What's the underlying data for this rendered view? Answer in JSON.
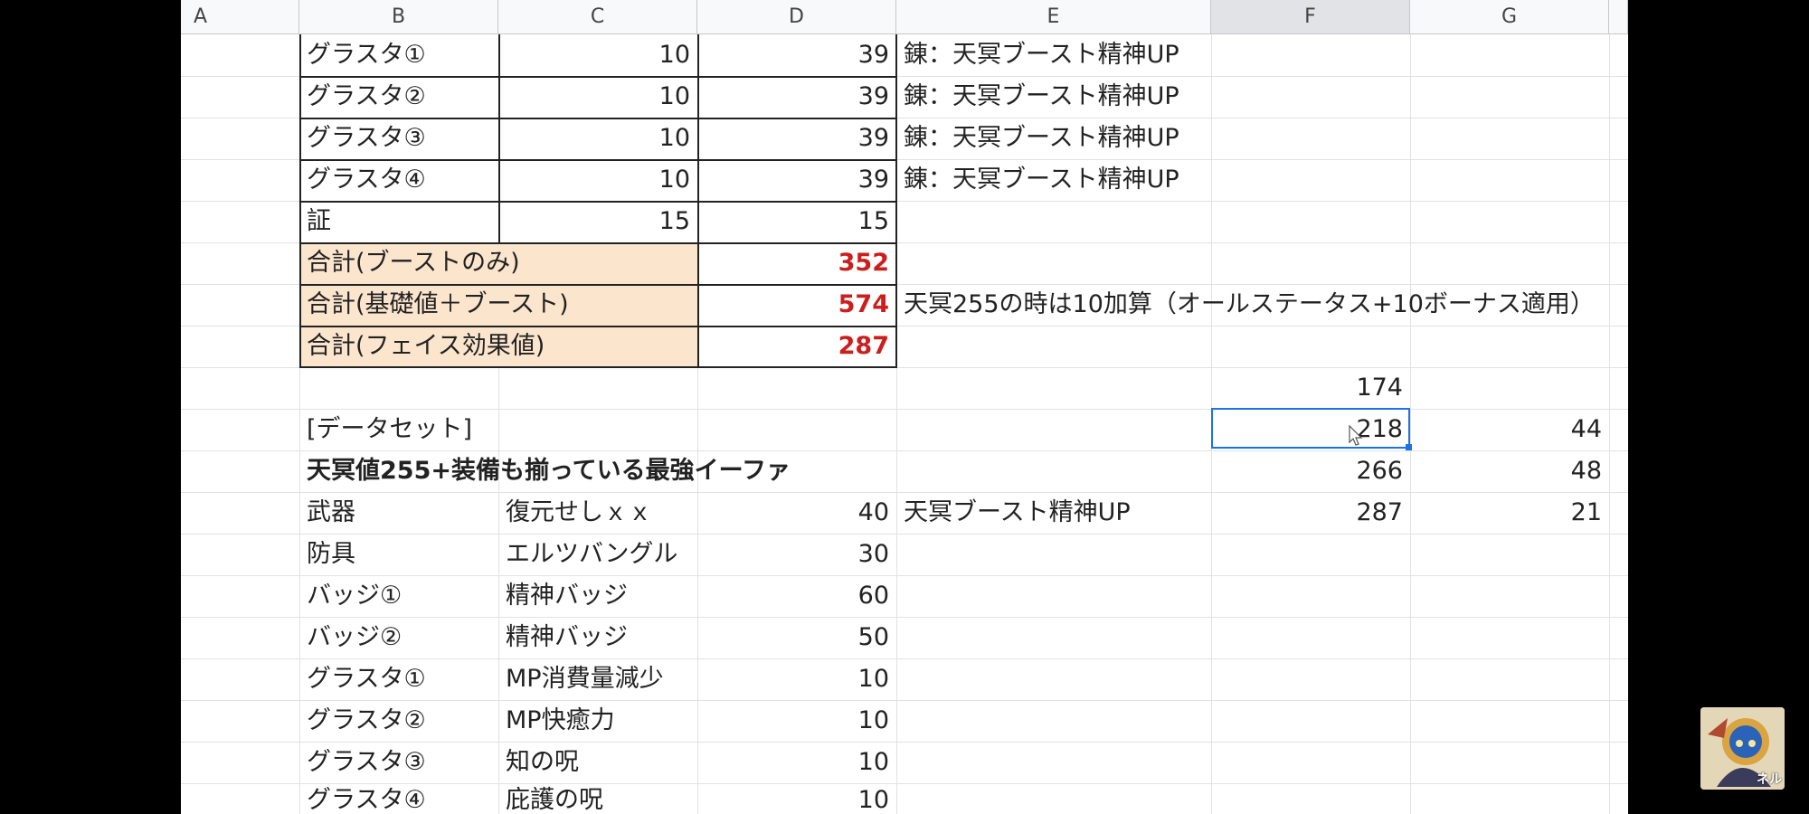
{
  "column_headers": [
    "A",
    "B",
    "C",
    "D",
    "E",
    "F",
    "G"
  ],
  "rows": [
    {
      "b": "グラスタ①",
      "c": "10",
      "d": "39",
      "e": "錬：天冥ブースト精神UP"
    },
    {
      "b": "グラスタ②",
      "c": "10",
      "d": "39",
      "e": "錬：天冥ブースト精神UP"
    },
    {
      "b": "グラスタ③",
      "c": "10",
      "d": "39",
      "e": "錬：天冥ブースト精神UP"
    },
    {
      "b": "グラスタ④",
      "c": "10",
      "d": "39",
      "e": "錬：天冥ブースト精神UP"
    },
    {
      "b": "証",
      "c": "15",
      "d": "15"
    }
  ],
  "totals": [
    {
      "label": "合計(ブーストのみ)",
      "value": "352"
    },
    {
      "label": "合計(基礎値＋ブースト)",
      "value": "574",
      "note": "天冥255の時は10加算（オールステータス+10ボーナス適用）"
    },
    {
      "label": "合計(フェイス効果値)",
      "value": "287"
    }
  ],
  "f_values": [
    "174",
    "218",
    "266",
    "287"
  ],
  "g_values": [
    "44",
    "48",
    "21"
  ],
  "dataset_label": "[データセット]",
  "dataset_title": "天冥値255+装備も揃っている最強イーファ",
  "equipment": [
    {
      "slot": "武器",
      "item": "復元せしｘｘ",
      "value": "40",
      "note": "天冥ブースト精神UP"
    },
    {
      "slot": "防具",
      "item": "エルツバングル",
      "value": "30"
    },
    {
      "slot": "バッジ①",
      "item": "精神バッジ",
      "value": "60"
    },
    {
      "slot": "バッジ②",
      "item": "精神バッジ",
      "value": "50"
    },
    {
      "slot": "グラスタ①",
      "item": "MP消費量減少",
      "value": "10"
    },
    {
      "slot": "グラスタ②",
      "item": "MP快癒力",
      "value": "10"
    },
    {
      "slot": "グラスタ③",
      "item": "知の呪",
      "value": "10"
    },
    {
      "slot": "グラスタ④",
      "item": "庇護の呪",
      "value": "10"
    }
  ],
  "overlay": {
    "avatar_text": "ネル"
  }
}
